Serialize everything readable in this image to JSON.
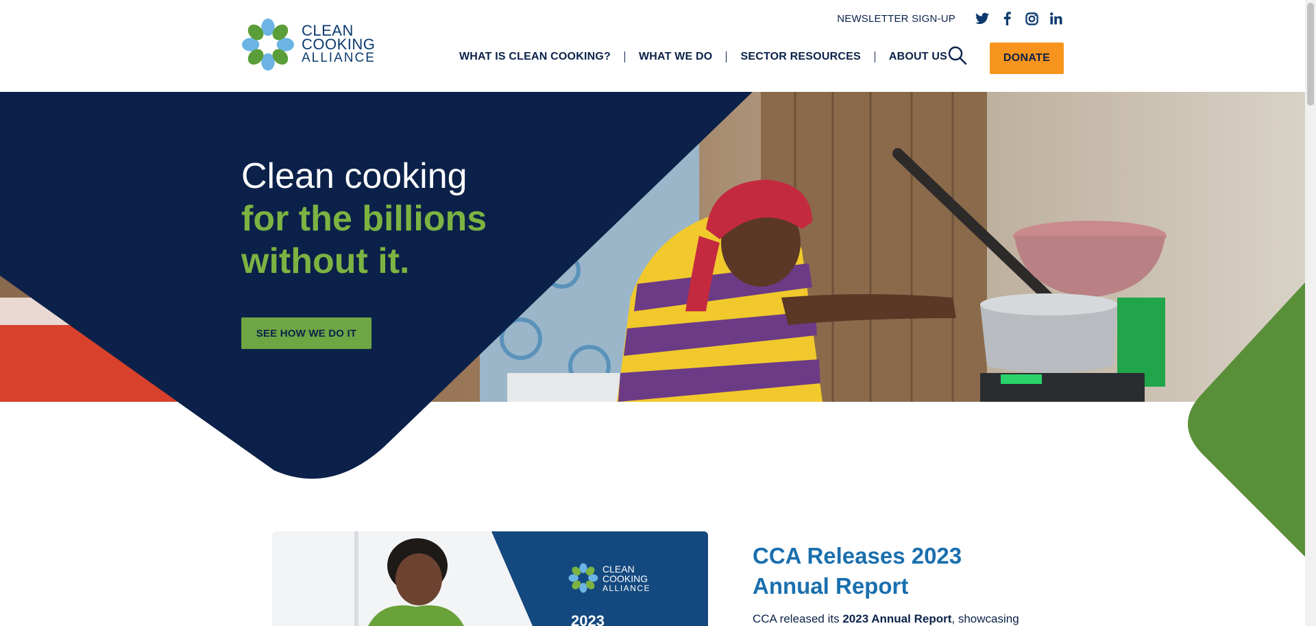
{
  "brand": {
    "logo_line1": "CLEAN",
    "logo_line2": "COOKING",
    "logo_line3": "ALLIANCE",
    "colors": {
      "navy": "#0b2149",
      "green": "#6ea644",
      "light_green": "#7cb342",
      "orange": "#f7941d",
      "blue": "#1a6fae"
    }
  },
  "topbar": {
    "newsletter": "NEWSLETTER SIGN-UP",
    "social": [
      "twitter-icon",
      "facebook-icon",
      "instagram-icon",
      "linkedin-icon"
    ]
  },
  "nav": {
    "items": [
      "WHAT IS CLEAN COOKING?",
      "WHAT WE DO",
      "SECTOR RESOURCES",
      "ABOUT US"
    ],
    "search_icon": "search-icon",
    "donate": "DONATE"
  },
  "hero": {
    "line1": "Clean cooking",
    "line2": "for the billions",
    "line3": "without it.",
    "cta": "SEE HOW WE DO IT"
  },
  "report": {
    "card_logo_line1": "CLEAN",
    "card_logo_line2": "COOKING",
    "card_logo_line3": "ALLIANCE",
    "card_year": "2023",
    "title_line1": "CCA Releases 2023",
    "title_line2": "Annual Report",
    "body_prefix": "CCA released its ",
    "body_bold": "2023 Annual Report",
    "body_suffix": ", showcasing"
  }
}
